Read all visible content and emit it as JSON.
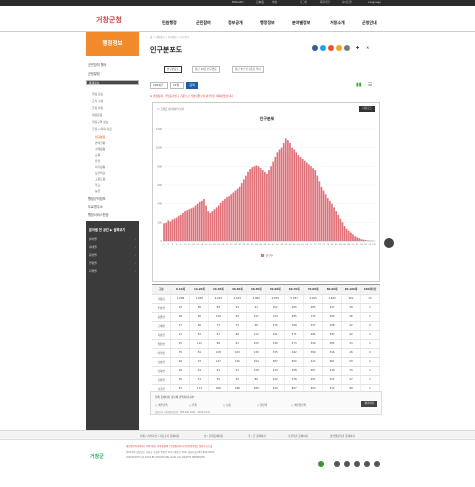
{
  "topbar": {
    "links": [
      "ENGLISH",
      "日本語",
      "中文",
      "로그인",
      "회원가입",
      "사이트맵",
      "Language"
    ]
  },
  "header": {
    "logo": "거창군청",
    "nav": [
      "민원행정",
      "군민참여",
      "정보공개",
      "행정정보",
      "분야별정보",
      "거창소개",
      "군청안내"
    ]
  },
  "sidebar": {
    "title": "행정정보",
    "items": [
      "군민참여 행사",
      "군정알림",
      "통계정보",
      "행정 정보",
      "조직 구성",
      "군정 살림",
      "재정운용",
      "행정구역 정보",
      "군정 시각화 자료"
    ],
    "sub": [
      "인구분포",
      "면적현황",
      "경제활동",
      "교육",
      "환경",
      "여가활동",
      "보건의료",
      "고용노동",
      "학교",
      "농업",
      "가축현황",
      "가동현황",
      "지방세"
    ],
    "active_sub": "인구분포",
    "more": [
      "행정규칙정보",
      "도로명주소",
      "행정서비스헌장"
    ],
    "dark": {
      "title": "분야별 전 공간 ▶ 살펴보기",
      "links": [
        "분야별",
        "세대별",
        "읍면별",
        "연령별",
        "지역별",
        "성별",
        "외국인"
      ]
    }
  },
  "breadcrumb": "홈 > 행정정보 > 통계정보 > 인구분포",
  "page_title": "인구분포도",
  "social": {
    "colors": [
      "#3b5998",
      "#1da1f2",
      "#e9563d",
      "#f5a623",
      "#7a7a7a"
    ]
  },
  "tabs": [
    "인구분포도",
    "최근 10년 인구변동",
    "최근 5년 인구증감 추이"
  ],
  "filter": {
    "year": "2022년",
    "month": "11월",
    "button": "검색"
  },
  "note": "※ 행정통계 - 주민등록인구 기준으로 작성되었으며 외국인은 제외되었습니다.",
  "chart_box": {
    "legend_hint": "그래프 내 데이터 보기",
    "download": "다운로드"
  },
  "chart_data": {
    "type": "bar",
    "title": "인구분포",
    "xlabel": "",
    "ylabel": "",
    "ylim": [
      0,
      1200
    ],
    "legend": "인구수",
    "categories": [
      "0",
      "1",
      "2",
      "3",
      "4",
      "5",
      "6",
      "7",
      "8",
      "9",
      "10",
      "11",
      "12",
      "13",
      "14",
      "15",
      "16",
      "17",
      "18",
      "19",
      "20",
      "21",
      "22",
      "23",
      "24",
      "25",
      "26",
      "27",
      "28",
      "29",
      "30",
      "31",
      "32",
      "33",
      "34",
      "35",
      "36",
      "37",
      "38",
      "39",
      "40",
      "41",
      "42",
      "43",
      "44",
      "45",
      "46",
      "47",
      "48",
      "49",
      "50",
      "51",
      "52",
      "53",
      "54",
      "55",
      "56",
      "57",
      "58",
      "59",
      "60",
      "61",
      "62",
      "63",
      "64",
      "65",
      "66",
      "67",
      "68",
      "69",
      "70",
      "71",
      "72",
      "73",
      "74",
      "75",
      "76",
      "77",
      "78",
      "79",
      "80",
      "81",
      "82",
      "83",
      "84",
      "85",
      "86",
      "87",
      "88",
      "89",
      "90",
      "91",
      "92",
      "93",
      "94",
      "95",
      "96",
      "97",
      "98",
      "99",
      "100"
    ],
    "values": [
      190,
      195,
      220,
      210,
      230,
      240,
      250,
      270,
      280,
      300,
      320,
      330,
      340,
      350,
      360,
      380,
      400,
      420,
      430,
      450,
      380,
      320,
      300,
      320,
      340,
      360,
      380,
      410,
      430,
      450,
      470,
      480,
      500,
      520,
      540,
      560,
      580,
      620,
      660,
      700,
      740,
      770,
      790,
      800,
      810,
      800,
      780,
      760,
      740,
      720,
      760,
      800,
      850,
      900,
      950,
      980,
      1000,
      1050,
      1100,
      1080,
      1050,
      1000,
      980,
      950,
      920,
      900,
      880,
      860,
      840,
      820,
      800,
      780,
      760,
      700,
      640,
      580,
      540,
      500,
      460,
      430,
      400,
      360,
      320,
      280,
      240,
      200,
      160,
      130,
      110,
      90,
      70,
      50,
      40,
      30,
      20,
      15,
      10,
      6,
      4,
      2,
      1
    ]
  },
  "table": {
    "headers": [
      "구분",
      "0-10세",
      "10-20세",
      "20-30세",
      "30-40세",
      "40-50세",
      "50-60세",
      "60-70세",
      "70-80세",
      "80-90세",
      "90-100세",
      "100세이상"
    ],
    "rows": [
      [
        "거창읍",
        "1,098",
        "1,856",
        "4,019",
        "2,615",
        "3,902",
        "4,875",
        "5,787",
        "4,265",
        "1,822",
        "302",
        "13"
      ],
      [
        "주상면",
        "22",
        "80",
        "84",
        "91",
        "91",
        "252",
        "405",
        "305",
        "247",
        "39",
        "1"
      ],
      [
        "웅양면",
        "38",
        "90",
        "120",
        "84",
        "147",
        "124",
        "285",
        "135",
        "200",
        "46",
        "1"
      ],
      [
        "고제면",
        "27",
        "60",
        "72",
        "74",
        "96",
        "276",
        "168",
        "227",
        "188",
        "42",
        "0"
      ],
      [
        "북상면",
        "21",
        "52",
        "67",
        "69",
        "112",
        "241",
        "371",
        "281",
        "247",
        "42",
        "1"
      ],
      [
        "위천면",
        "45",
        "112",
        "98",
        "97",
        "155",
        "318",
        "473",
        "326",
        "285",
        "33",
        "1"
      ],
      [
        "마리면",
        "35",
        "81",
        "128",
        "100",
        "130",
        "335",
        "442",
        "389",
        "316",
        "46",
        "0"
      ],
      [
        "남상면",
        "94",
        "72",
        "127",
        "126",
        "194",
        "387",
        "550",
        "411",
        "361",
        "59",
        "1"
      ],
      [
        "남하면",
        "26",
        "44",
        "61",
        "51",
        "128",
        "219",
        "358",
        "267",
        "249",
        "33",
        "1"
      ],
      [
        "신원면",
        "36",
        "31",
        "55",
        "42",
        "89",
        "222",
        "378",
        "351",
        "252",
        "47",
        "1"
      ],
      [
        "가조면",
        "87",
        "173",
        "206",
        "186",
        "285",
        "610",
        "857",
        "653",
        "512",
        "89",
        "1"
      ],
      [
        "가북면",
        "31",
        "47",
        "45",
        "38",
        "87",
        "228",
        "378",
        "250",
        "227",
        "36",
        "2"
      ],
      [
        "합계",
        "1,512",
        "1,816",
        "5,698",
        "4,703",
        "7,452",
        "11,253",
        "10,746",
        "8,402",
        "5,012",
        "766",
        "25"
      ]
    ]
  },
  "survey": {
    "question": "현재 홈페이지 정보에 만족하십니까?",
    "options": [
      "매우만족",
      "만족",
      "보통",
      "불만족",
      "매우불만족"
    ],
    "submit": "평가하기",
    "dept": "담당부서 기획예산담당관",
    "tel": "055-940-3051",
    "date": "2022-12-01"
  },
  "footer": {
    "links": [
      "인재 / 지식자산 / 자료조사 홈페이지",
      "인 / 문화홈페이지",
      "국 / 군 홈페이지",
      "소관기관 홈페이지",
      "관련행정기관 홈페이지"
    ],
    "policy": "개인정보처리방침 | 이용약관 | 저작권정책 | 영상정보처리기기운영방침 | 찾아오시는길",
    "address": "(50139) 경상남도 거창군 거창읍 중앙로 103 (중앙로 103) 대표전화 055-940-3000",
    "copyright": "COPYRIGHT (C) 2022 BY GEOCHANG GUN. ALL RIGHTS RESERVED.",
    "logo": "거창군"
  }
}
